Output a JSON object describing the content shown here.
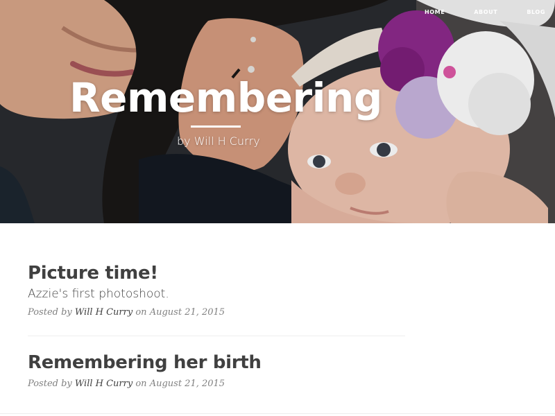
{
  "nav": {
    "items": [
      {
        "label": "HOME"
      },
      {
        "label": "ABOUT"
      },
      {
        "label": "BLOG"
      }
    ]
  },
  "hero": {
    "title": "Remembering",
    "subtitle": "by Will H Curry"
  },
  "posts": [
    {
      "title": "Picture time!",
      "subtitle": "Azzie's first photoshoot.",
      "meta_prefix": "Posted by",
      "author": "Will H Curry",
      "meta_on": "on August 21, 2015"
    },
    {
      "title": "Remembering her birth",
      "meta_prefix": "Posted by",
      "author": "Will H Curry",
      "meta_on": "on August 21, 2015"
    }
  ],
  "colors": {
    "text": "#404040",
    "meta": "#808080",
    "divider": "#eeeeee",
    "headband_purple": "#8e2a8c",
    "headband_lavender": "#c9b6e0"
  }
}
